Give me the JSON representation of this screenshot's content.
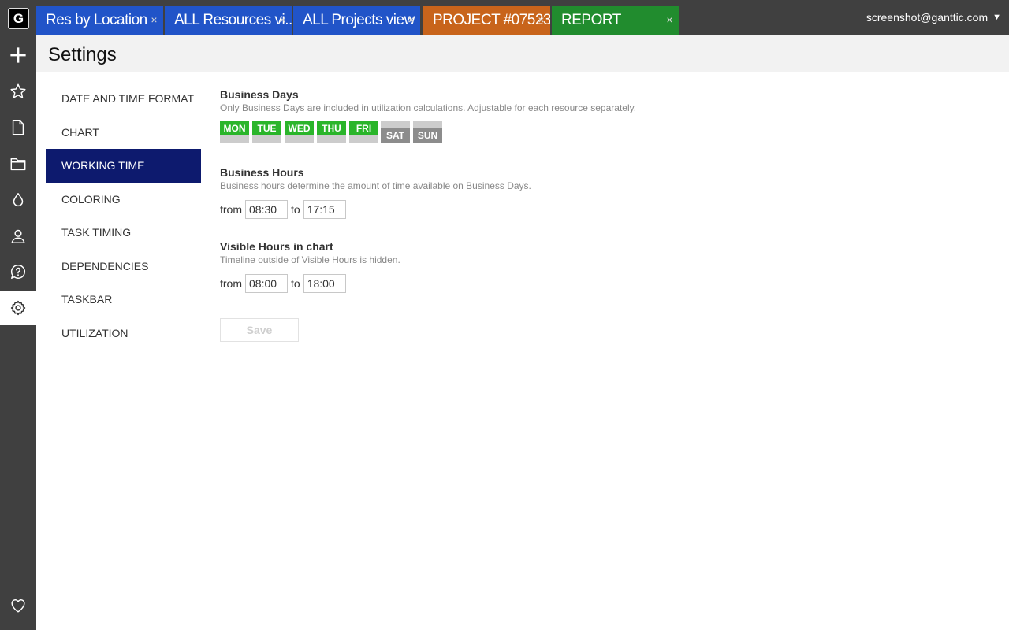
{
  "app": {
    "logo_letter": "G"
  },
  "tabs": [
    {
      "label": "Res by Location",
      "color": "#2154c8"
    },
    {
      "label": "ALL Resources vi...",
      "color": "#2154c8"
    },
    {
      "label": "ALL Projects view",
      "color": "#2154c8"
    },
    {
      "label": "PROJECT #07523",
      "color": "#c8641b"
    },
    {
      "label": "REPORT",
      "color": "#218c2e"
    }
  ],
  "tab_close_glyph": "×",
  "user": {
    "email": "screenshot@ganttic.com",
    "caret": "▼"
  },
  "rail_icons": [
    "plus-icon",
    "star-icon",
    "document-icon",
    "folder-icon",
    "drop-icon",
    "user-icon",
    "help-icon",
    "gear-icon",
    "heart-icon"
  ],
  "page": {
    "title": "Settings"
  },
  "nav": {
    "items": [
      "DATE AND TIME FORMAT",
      "CHART",
      "WORKING TIME",
      "COLORING",
      "TASK TIMING",
      "DEPENDENCIES",
      "TASKBAR",
      "UTILIZATION"
    ],
    "active": "WORKING TIME"
  },
  "business_days": {
    "title": "Business Days",
    "description": "Only Business Days are included in utilization calculations. Adjustable for each resource separately.",
    "days": [
      {
        "label": "MON",
        "enabled": true
      },
      {
        "label": "TUE",
        "enabled": true
      },
      {
        "label": "WED",
        "enabled": true
      },
      {
        "label": "THU",
        "enabled": true
      },
      {
        "label": "FRI",
        "enabled": true
      },
      {
        "label": "SAT",
        "enabled": false
      },
      {
        "label": "SUN",
        "enabled": false
      }
    ]
  },
  "business_hours": {
    "title": "Business Hours",
    "description": "Business hours determine the amount of time available on Business Days.",
    "from_label": "from",
    "to_label": "to",
    "from": "08:30",
    "to": "17:15"
  },
  "visible_hours": {
    "title": "Visible Hours in chart",
    "description": "Timeline outside of Visible Hours is hidden.",
    "from_label": "from",
    "to_label": "to",
    "from": "08:00",
    "to": "18:00"
  },
  "save_label": "Save"
}
